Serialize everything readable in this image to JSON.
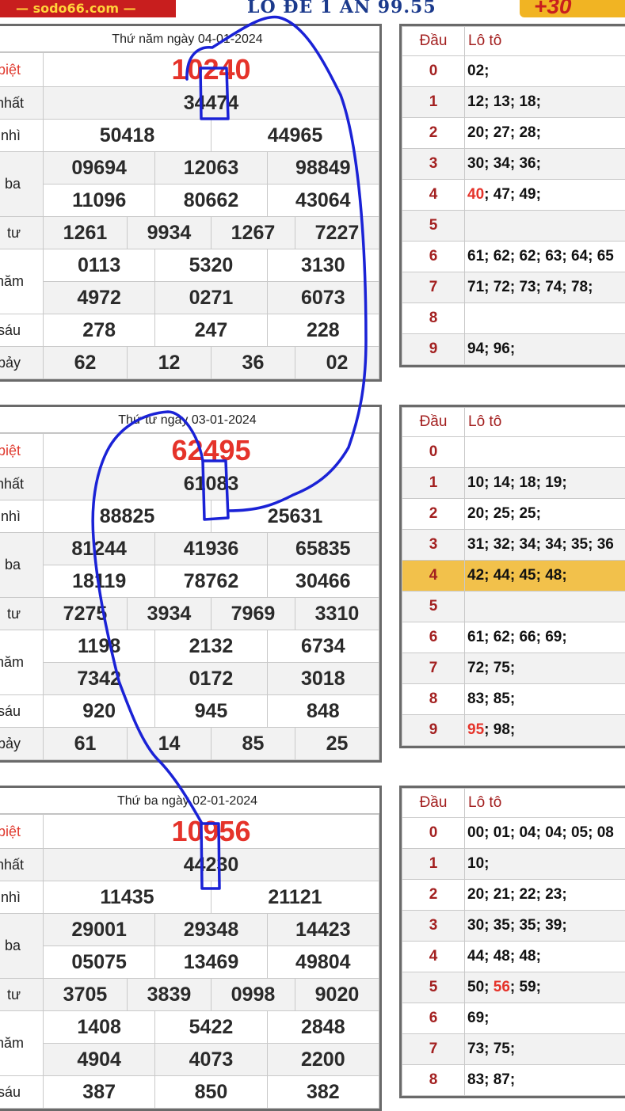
{
  "banner": {
    "logo": "— sodo66.com —",
    "promo": "LÔ ĐỀ 1 ĂN 99.55",
    "badge": "+30"
  },
  "colors": {
    "special": "#e5332a",
    "highlight_row": "#f2c14b",
    "ink": "#1a22d6",
    "label_red": "#e03a2f"
  },
  "draws": [
    {
      "date": "Thứ năm ngày 04-01-2024",
      "rows": [
        {
          "label": "biệt",
          "values": [
            "10240"
          ],
          "special": true
        },
        {
          "label": "nhất",
          "values": [
            "34474"
          ]
        },
        {
          "label": "nhì",
          "values": [
            "50418",
            "44965"
          ]
        },
        {
          "label": "ba",
          "values": [
            "09694",
            "12063",
            "98849"
          ]
        },
        {
          "label": "",
          "values": [
            "11096",
            "80662",
            "43064"
          ]
        },
        {
          "label": "tư",
          "values": [
            "1261",
            "9934",
            "1267",
            "7227"
          ]
        },
        {
          "label": "năm",
          "values": [
            "0113",
            "5320",
            "3130"
          ]
        },
        {
          "label": "",
          "values": [
            "4972",
            "0271",
            "6073"
          ]
        },
        {
          "label": "sáu",
          "values": [
            "278",
            "247",
            "228"
          ]
        },
        {
          "label": "bảy",
          "values": [
            "62",
            "12",
            "36",
            "02"
          ]
        }
      ],
      "loto_header": {
        "dau": "Đầu",
        "loto": "Lô tô"
      },
      "loto": [
        {
          "dau": "0",
          "hot": "",
          "rest": "02;"
        },
        {
          "dau": "1",
          "hot": "",
          "rest": "12; 13; 18;"
        },
        {
          "dau": "2",
          "hot": "",
          "rest": "20; 27; 28;"
        },
        {
          "dau": "3",
          "hot": "",
          "rest": "30; 34; 36;"
        },
        {
          "dau": "4",
          "hot": "40",
          "rest": "; 47; 49;"
        },
        {
          "dau": "5",
          "hot": "",
          "rest": ""
        },
        {
          "dau": "6",
          "hot": "",
          "rest": "61; 62; 62; 63; 64; 65"
        },
        {
          "dau": "7",
          "hot": "",
          "rest": "71; 72; 73; 74; 78;"
        },
        {
          "dau": "8",
          "hot": "",
          "rest": ""
        },
        {
          "dau": "9",
          "hot": "",
          "rest": "94; 96;"
        }
      ]
    },
    {
      "date": "Thứ tư ngày 03-01-2024",
      "rows": [
        {
          "label": "biệt",
          "values": [
            "62495"
          ],
          "special": true
        },
        {
          "label": "nhất",
          "values": [
            "61083"
          ]
        },
        {
          "label": "nhì",
          "values": [
            "88825",
            "25631"
          ]
        },
        {
          "label": "ba",
          "values": [
            "81244",
            "41936",
            "65835"
          ]
        },
        {
          "label": "",
          "values": [
            "18119",
            "78762",
            "30466"
          ]
        },
        {
          "label": "tư",
          "values": [
            "7275",
            "3934",
            "7969",
            "3310"
          ]
        },
        {
          "label": "năm",
          "values": [
            "1198",
            "2132",
            "6734"
          ]
        },
        {
          "label": "",
          "values": [
            "7342",
            "0172",
            "3018"
          ]
        },
        {
          "label": "sáu",
          "values": [
            "920",
            "945",
            "848"
          ]
        },
        {
          "label": "bảy",
          "values": [
            "61",
            "14",
            "85",
            "25"
          ]
        }
      ],
      "loto_header": {
        "dau": "Đầu",
        "loto": "Lô tô"
      },
      "loto": [
        {
          "dau": "0",
          "hot": "",
          "rest": ""
        },
        {
          "dau": "1",
          "hot": "",
          "rest": "10; 14; 18; 19;"
        },
        {
          "dau": "2",
          "hot": "",
          "rest": "20; 25; 25;"
        },
        {
          "dau": "3",
          "hot": "",
          "rest": "31; 32; 34; 34; 35; 36"
        },
        {
          "dau": "4",
          "hot": "",
          "rest": "42; 44; 45; 48;",
          "highlight": true
        },
        {
          "dau": "5",
          "hot": "",
          "rest": ""
        },
        {
          "dau": "6",
          "hot": "",
          "rest": "61; 62; 66; 69;"
        },
        {
          "dau": "7",
          "hot": "",
          "rest": "72; 75;"
        },
        {
          "dau": "8",
          "hot": "",
          "rest": "83; 85;"
        },
        {
          "dau": "9",
          "hot": "95",
          "rest": "; 98;"
        }
      ]
    },
    {
      "date": "Thứ ba ngày 02-01-2024",
      "rows": [
        {
          "label": "biệt",
          "values": [
            "10956"
          ],
          "special": true
        },
        {
          "label": "nhất",
          "values": [
            "44230"
          ]
        },
        {
          "label": "nhì",
          "values": [
            "11435",
            "21121"
          ]
        },
        {
          "label": "ba",
          "values": [
            "29001",
            "29348",
            "14423"
          ]
        },
        {
          "label": "",
          "values": [
            "05075",
            "13469",
            "49804"
          ]
        },
        {
          "label": "tư",
          "values": [
            "3705",
            "3839",
            "0998",
            "9020"
          ]
        },
        {
          "label": "năm",
          "values": [
            "1408",
            "5422",
            "2848"
          ]
        },
        {
          "label": "",
          "values": [
            "4904",
            "4073",
            "2200"
          ]
        },
        {
          "label": "sáu",
          "values": [
            "387",
            "850",
            "382"
          ]
        }
      ],
      "loto_header": {
        "dau": "Đầu",
        "loto": "Lô tô"
      },
      "loto": [
        {
          "dau": "0",
          "hot": "",
          "rest": "00; 01; 04; 04; 05; 08"
        },
        {
          "dau": "1",
          "hot": "",
          "rest": "10;"
        },
        {
          "dau": "2",
          "hot": "",
          "rest": "20; 21; 22; 23;"
        },
        {
          "dau": "3",
          "hot": "",
          "rest": "30; 35; 35; 39;"
        },
        {
          "dau": "4",
          "hot": "",
          "rest": "44; 48; 48;"
        },
        {
          "dau": "5",
          "hot": "",
          "rest": "50; ",
          "hot2": "56",
          "rest2": "; 59;"
        },
        {
          "dau": "6",
          "hot": "",
          "rest": "69;"
        },
        {
          "dau": "7",
          "hot": "",
          "rest": "73; 75;"
        },
        {
          "dau": "8",
          "hot": "",
          "rest": "83; 87;"
        }
      ]
    }
  ]
}
